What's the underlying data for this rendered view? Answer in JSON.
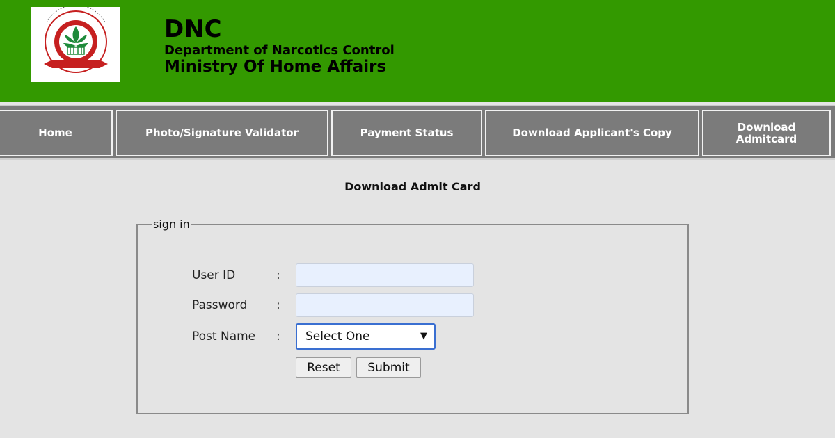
{
  "header": {
    "title": "DNC",
    "department": "Department of Narcotics Control",
    "ministry": "Ministry Of Home Affairs",
    "logo": {
      "icon": "dnc-emblem-icon",
      "arc_text": "DEPARTMENT OF NARCOTICS CONTROL BANGLADESH",
      "ribbon_text": "মাদকদ্রব্য নিয়ন্ত্রণ"
    },
    "bg_color": "#339900"
  },
  "nav": {
    "items": [
      {
        "label": "Home"
      },
      {
        "label": "Photo/Signature Validator"
      },
      {
        "label": "Payment Status"
      },
      {
        "label": "Download Applicant's Copy"
      },
      {
        "label": "Download Admitcard"
      }
    ],
    "bg_color": "#7b7b7b"
  },
  "main": {
    "heading": "Download Admit Card",
    "form": {
      "legend": "sign in",
      "user_id_label": "User ID",
      "password_label": "Password",
      "post_name_label": "Post Name",
      "colon": ":",
      "user_id_value": "",
      "password_value": "",
      "post_select_value": "Select One",
      "select_arrow_icon": "triangle-down-icon",
      "reset_label": "Reset",
      "submit_label": "Submit"
    }
  }
}
